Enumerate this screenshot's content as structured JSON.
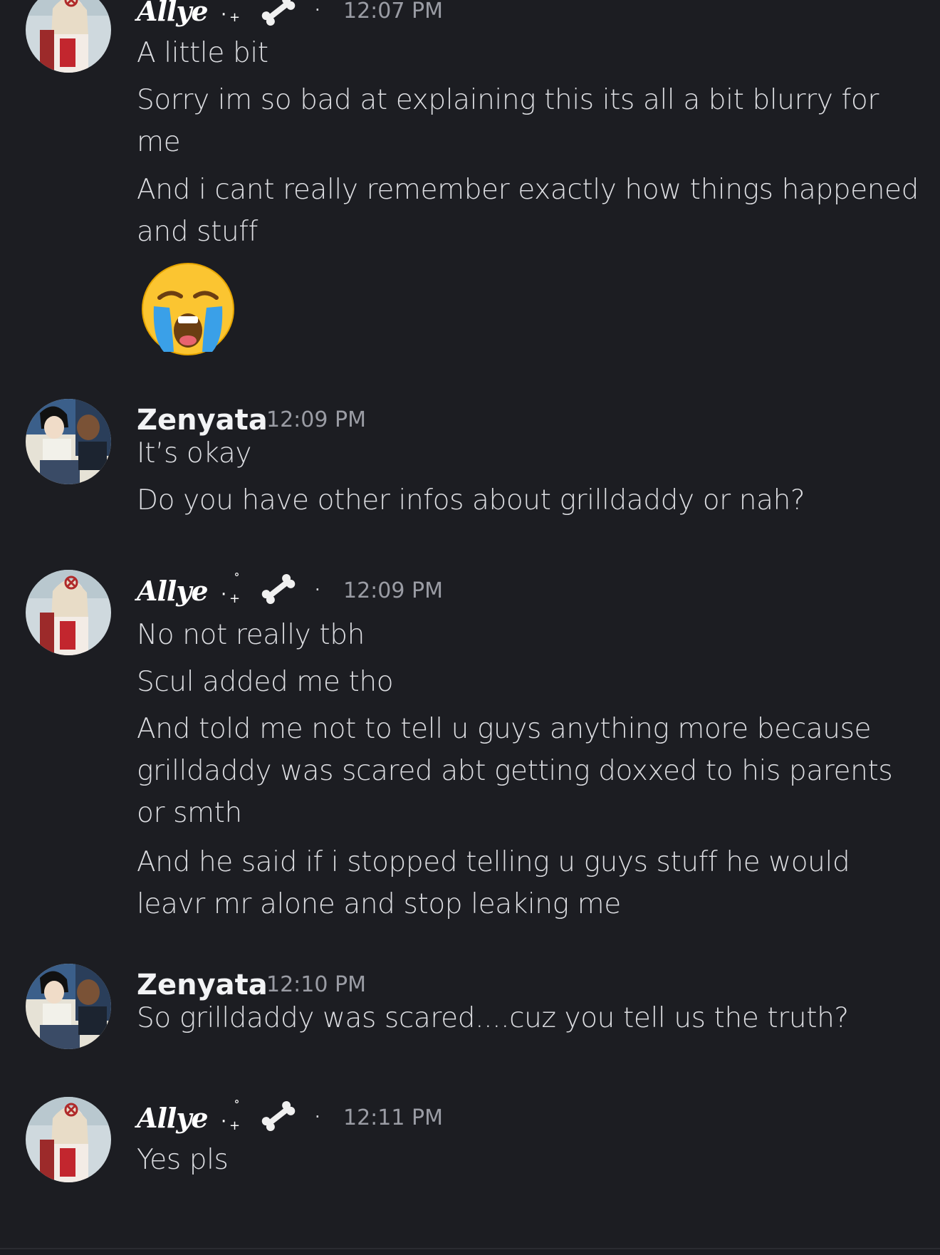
{
  "messages": [
    {
      "author": "Allye",
      "deco": "· ˚ +",
      "sep": "·",
      "time": "12:07 PM",
      "lines": [
        "A little bit",
        "Sorry im so bad at explaining this its all a bit blurry for me",
        "And i cant really remember exactly how things happened and stuff"
      ],
      "emoji": "loudly-crying-face"
    },
    {
      "author": "Zenyata",
      "time": "12:09 PM",
      "lines": [
        "It’s okay",
        "Do you have other infos about grilldaddy or nah?"
      ]
    },
    {
      "author": "Allye",
      "deco": "· ˚ +",
      "sep": "·",
      "time": "12:09 PM",
      "lines": [
        "No not really tbh",
        "Scul added me tho",
        "And told me not to tell u guys anything more because grilldaddy was scared abt getting doxxed to his parents or smth",
        "And he said if i stopped telling u guys stuff he would leavr mr alone and stop leaking me"
      ]
    },
    {
      "author": "Zenyata",
      "time": "12:10 PM",
      "lines": [
        "So grilldaddy was scared....cuz you tell us the truth?"
      ]
    },
    {
      "author": "Allye",
      "deco": "· ˚ +",
      "sep": "·",
      "time": "12:11 PM",
      "lines": [
        "Yes pls"
      ]
    }
  ],
  "colors": {
    "background": "#1c1d22",
    "text": "#dcdde1",
    "username": "#f2f3f5",
    "timestamp": "#9a9ca4"
  }
}
